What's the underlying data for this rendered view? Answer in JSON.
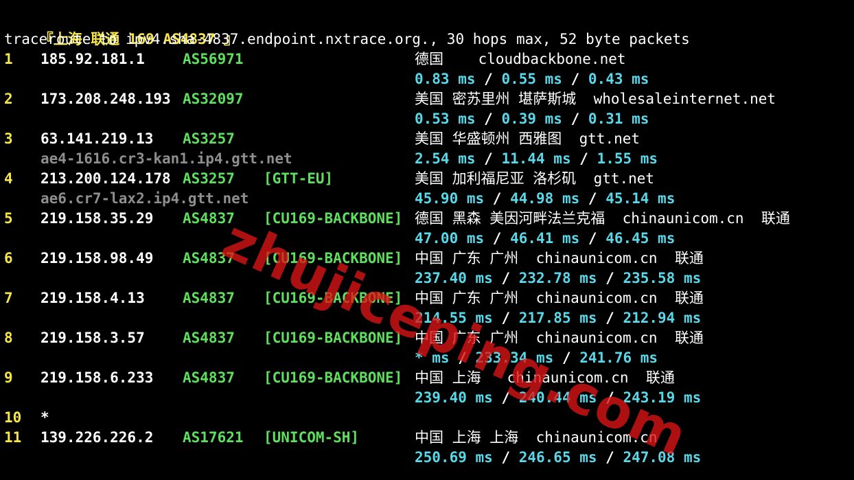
{
  "header": {
    "title_open": "『上海 联通 ",
    "title_bold": "169 AS4837",
    "title_close": " 』",
    "command": "traceroute to ipv4.sha-4837.endpoint.nxtrace.org., 30 hops max, 52 byte packets"
  },
  "hops": [
    {
      "num": "1",
      "ip": "185.92.181.1",
      "as": "AS56971",
      "tag": "",
      "geo": "德国    cloudbackbone.net",
      "rdns": "",
      "times": [
        "0.83 ms",
        "0.55 ms",
        "0.43 ms"
      ]
    },
    {
      "num": "2",
      "ip": "173.208.248.193",
      "as": "AS32097",
      "tag": "",
      "geo": "美国 密苏里州 堪萨斯城  wholesaleinternet.net",
      "rdns": "",
      "times": [
        "0.53 ms",
        "0.39 ms",
        "0.31 ms"
      ]
    },
    {
      "num": "3",
      "ip": "63.141.219.13",
      "as": "AS3257",
      "tag": "",
      "geo": "美国 华盛顿州 西雅图  gtt.net",
      "rdns": "ae4-1616.cr3-kan1.ip4.gtt.net",
      "times": [
        "2.54 ms",
        "11.44 ms",
        "1.55 ms"
      ]
    },
    {
      "num": "4",
      "ip": "213.200.124.178",
      "as": "AS3257",
      "tag": "[GTT-EU]",
      "geo": "美国 加利福尼亚 洛杉矶  gtt.net",
      "rdns": "ae6.cr7-lax2.ip4.gtt.net",
      "times": [
        "45.90 ms",
        "44.98 ms",
        "45.14 ms"
      ]
    },
    {
      "num": "5",
      "ip": "219.158.35.29",
      "as": "AS4837",
      "tag": "[CU169-BACKBONE]",
      "geo": "德国 黑森 美因河畔法兰克福  chinaunicom.cn  联通",
      "rdns": "",
      "times": [
        "47.00 ms",
        "46.41 ms",
        "46.45 ms"
      ]
    },
    {
      "num": "6",
      "ip": "219.158.98.49",
      "as": "AS4837",
      "tag": "[CU169-BACKBONE]",
      "geo": "中国 广东 广州  chinaunicom.cn  联通",
      "rdns": "",
      "times": [
        "237.40 ms",
        "232.78 ms",
        "235.58 ms"
      ]
    },
    {
      "num": "7",
      "ip": "219.158.4.13",
      "as": "AS4837",
      "tag": "[CU169-BACKBONE]",
      "geo": "中国 广东 广州  chinaunicom.cn  联通",
      "rdns": "",
      "times": [
        "214.55 ms",
        "217.85 ms",
        "212.94 ms"
      ]
    },
    {
      "num": "8",
      "ip": "219.158.3.57",
      "as": "AS4837",
      "tag": "[CU169-BACKBONE]",
      "geo": "中国 广东 广州  chinaunicom.cn  联通",
      "rdns": "",
      "times": [
        "* ms",
        "233.34 ms",
        "241.76 ms"
      ]
    },
    {
      "num": "9",
      "ip": "219.158.6.233",
      "as": "AS4837",
      "tag": "[CU169-BACKBONE]",
      "geo": "中国 上海   chinaunicom.cn  联通",
      "rdns": "",
      "times": [
        "239.40 ms",
        "240.44 ms",
        "243.19 ms"
      ]
    },
    {
      "num": "10",
      "ip": "*",
      "as": "",
      "tag": "",
      "geo": "",
      "rdns": "",
      "times": []
    },
    {
      "num": "11",
      "ip": "139.226.226.2",
      "as": "AS17621",
      "tag": "[UNICOM-SH]",
      "geo": "中国 上海 上海  chinaunicom.cn",
      "rdns": "",
      "times": [
        "250.69 ms",
        "246.65 ms",
        "247.08 ms"
      ]
    }
  ],
  "separator": " / ",
  "watermark": "zhujiceping.com"
}
